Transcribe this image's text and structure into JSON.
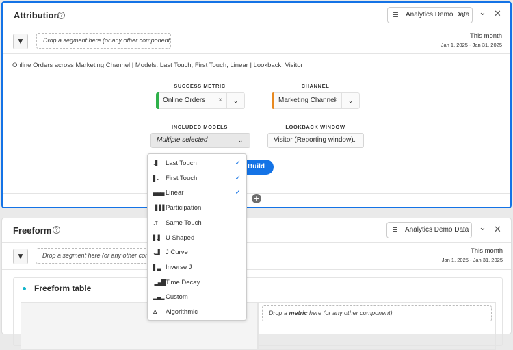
{
  "attribution": {
    "title": "Attribution",
    "help": "?",
    "datasource": "Analytics Demo Data",
    "segment_drop": "Drop a segment here (or any other component)",
    "date_label": "This month",
    "date_range": "Jan 1, 2025 - Jan 31, 2025",
    "summary": "Online Orders across Marketing Channel | Models: Last Touch, First Touch, Linear | Lookback: Visitor",
    "success_metric_label": "SUCCESS METRIC",
    "success_metric": "Online Orders",
    "channel_label": "CHANNEL",
    "channel": "Marketing Channel",
    "included_models_label": "INCLUDED MODELS",
    "included_models": "Multiple selected",
    "lookback_label": "LOOKBACK WINDOW",
    "lookback": "Visitor (Reporting window)",
    "build": "Build",
    "colors": {
      "metric": "#2fb14a",
      "channel": "#e8891f",
      "accent": "#1473e6"
    }
  },
  "models_menu": [
    {
      "label": "Last Touch",
      "icon": "last-touch",
      "checked": true
    },
    {
      "label": "First Touch",
      "icon": "first-touch",
      "checked": true
    },
    {
      "label": "Linear",
      "icon": "linear",
      "checked": true
    },
    {
      "label": "Participation",
      "icon": "participation",
      "checked": false
    },
    {
      "label": "Same Touch",
      "icon": "same-touch",
      "checked": false
    },
    {
      "label": "U Shaped",
      "icon": "u-shaped",
      "checked": false
    },
    {
      "label": "J Curve",
      "icon": "j-curve",
      "checked": false
    },
    {
      "label": "Inverse J",
      "icon": "inverse-j",
      "checked": false
    },
    {
      "label": "Time Decay",
      "icon": "time-decay",
      "checked": false
    },
    {
      "label": "Custom",
      "icon": "custom",
      "checked": false
    },
    {
      "label": "Algorithmic",
      "icon": "algorithmic",
      "checked": false
    }
  ],
  "freeform": {
    "title": "Freeform",
    "help": "?",
    "datasource": "Analytics Demo Data",
    "segment_drop": "Drop a segment here (or any other component)",
    "date_label": "This month",
    "date_range": "Jan 1, 2025 - Jan 31, 2025",
    "table_title": "Freeform table",
    "metric_drop_pre": "Drop a ",
    "metric_drop_bold": "metric",
    "metric_drop_post": " here (or any other component)"
  }
}
